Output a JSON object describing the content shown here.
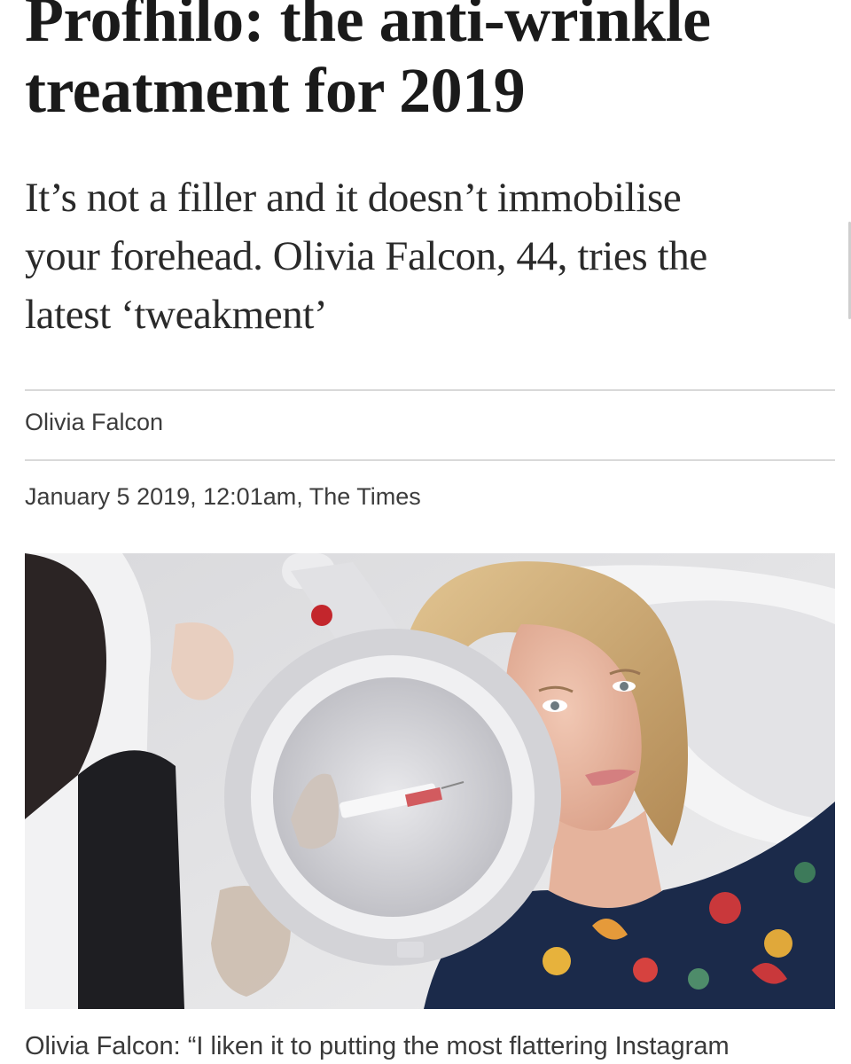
{
  "article": {
    "headline_line1": "Profhilo: the anti-wrinkle",
    "headline_line2": "treatment for 2019",
    "standfirst_line1": "It’s not a filler and it doesn’t immobilise",
    "standfirst_line2": "your forehead. Olivia Falcon, 44, tries the",
    "standfirst_line3": "latest ‘tweakment’",
    "author": "Olivia Falcon",
    "dateline": "January 5 2019, 12:01am, The Times",
    "caption": "Olivia Falcon: “I liken it to putting the most flattering Instagram"
  },
  "colors": {
    "text": "#1a1a1a",
    "meta_text": "#3c3c3c",
    "rule": "#d9d9d9",
    "background": "#ffffff"
  }
}
